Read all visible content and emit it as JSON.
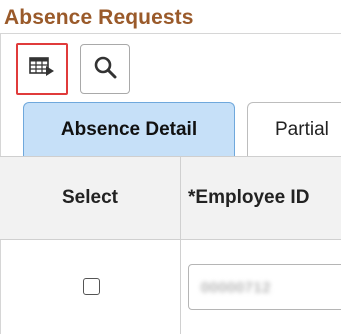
{
  "page": {
    "title": "Absence Requests"
  },
  "toolbar": {
    "grid_icon": "grid-view-icon",
    "search_icon": "search-icon"
  },
  "tabs": [
    {
      "label": "Absence Detail",
      "active": true
    },
    {
      "label": "Partial",
      "active": false
    }
  ],
  "table": {
    "headers": [
      "Select",
      "*Employee ID"
    ],
    "rows": [
      {
        "selected": false,
        "employee_id": "00000712"
      }
    ]
  },
  "colors": {
    "title": "#9a5a2a",
    "active_tab_bg": "#c6e0f8",
    "highlight_border": "#e03b3b",
    "header_bg": "#f2f2f2"
  }
}
